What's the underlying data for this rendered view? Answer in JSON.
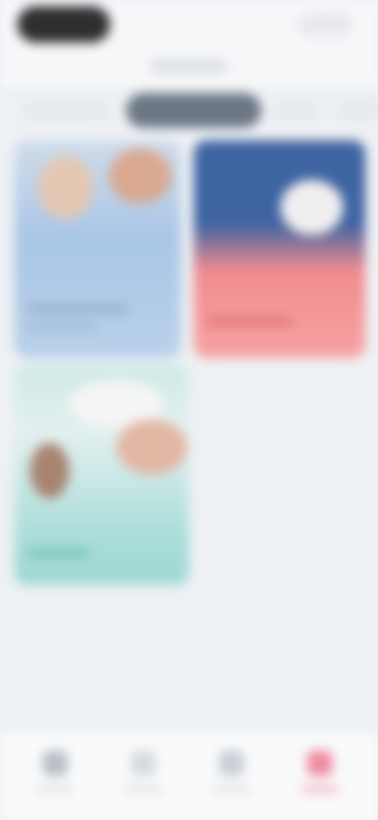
{
  "theme": {
    "active_tab_color": "#6c7785",
    "accent_color": "#f08aa1",
    "background": "#eef1f4"
  },
  "header": {
    "left_pill_icon": "account-pill",
    "right_action_icon": "menu-dots"
  },
  "tabs": [
    {
      "active": false
    },
    {
      "active": true
    },
    {
      "active": false
    },
    {
      "active": false
    }
  ],
  "cards": [
    {
      "icon": "image-thumbnail"
    },
    {
      "icon": "image-thumbnail"
    },
    {
      "icon": "image-thumbnail"
    }
  ],
  "bottom_nav": {
    "selected_index": 3,
    "items": [
      {
        "icon": "home-icon"
      },
      {
        "icon": "search-icon"
      },
      {
        "icon": "library-icon"
      },
      {
        "icon": "profile-icon"
      }
    ]
  }
}
